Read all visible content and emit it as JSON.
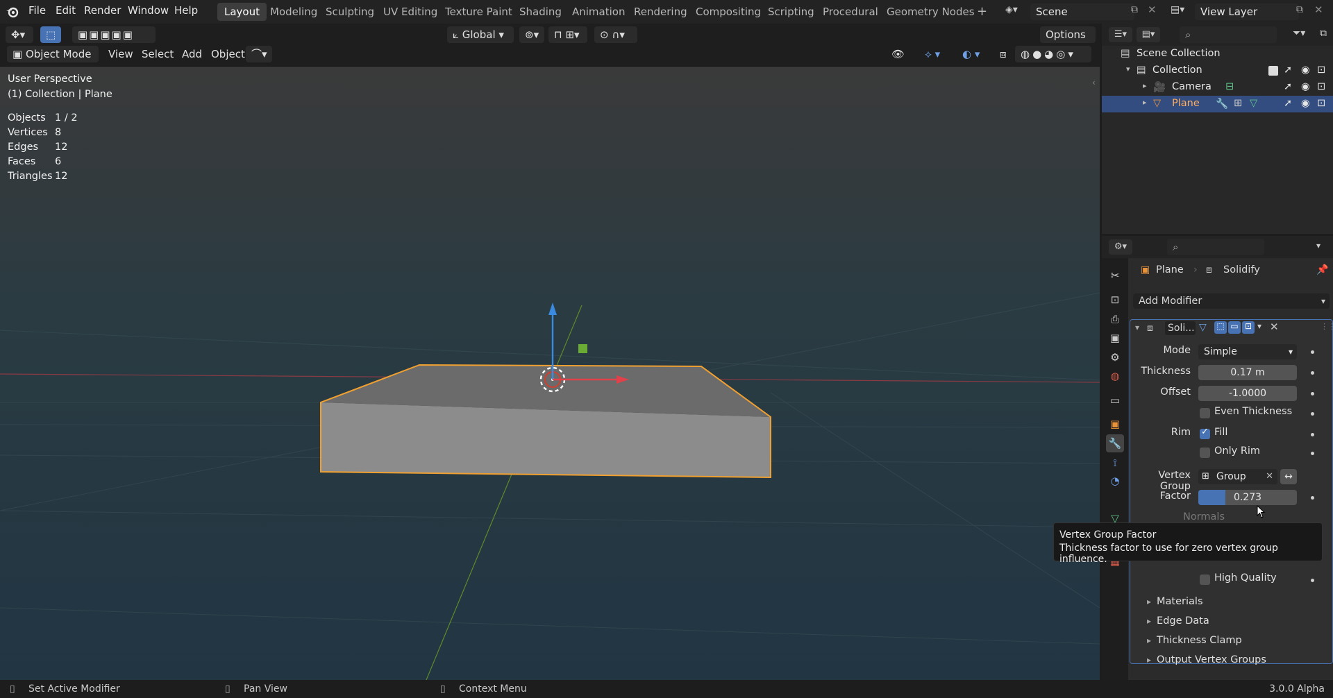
{
  "app": {
    "version": "3.0.0 Alpha"
  },
  "topbar": {
    "menus": [
      "File",
      "Edit",
      "Render",
      "Window",
      "Help"
    ],
    "workspaces": [
      "Layout",
      "Modeling",
      "Sculpting",
      "UV Editing",
      "Texture Paint",
      "Shading",
      "Animation",
      "Rendering",
      "Compositing",
      "Scripting",
      "Procedural",
      "Geometry Nodes"
    ],
    "active_workspace": "Layout",
    "add_tab": "+",
    "scene": "Scene",
    "view_layer": "View Layer"
  },
  "viewport_header": {
    "transform_orientation": "Global",
    "options": "Options",
    "mode": "Object Mode",
    "menus": [
      "View",
      "Select",
      "Add",
      "Object"
    ]
  },
  "viewport": {
    "perspective": "User Perspective",
    "context": "(1) Collection | Plane",
    "stats": [
      {
        "label": "Objects",
        "value": "1 / 2"
      },
      {
        "label": "Vertices",
        "value": "8"
      },
      {
        "label": "Edges",
        "value": "12"
      },
      {
        "label": "Faces",
        "value": "6"
      },
      {
        "label": "Triangles",
        "value": "12"
      }
    ],
    "colors": {
      "selection_outline": "#f0a030",
      "x_axis": "#e0414a",
      "y_axis": "#7fa83a",
      "z_axis": "#3a8ae0"
    }
  },
  "outliner": {
    "root": "Scene Collection",
    "items": [
      {
        "name": "Collection",
        "indent": 1,
        "icon": "collection-icon"
      },
      {
        "name": "Camera",
        "indent": 2,
        "icon": "camera-icon"
      },
      {
        "name": "Plane",
        "indent": 2,
        "icon": "mesh-icon",
        "selected": true
      }
    ]
  },
  "properties": {
    "breadcrumb": {
      "object": "Plane",
      "modifier": "Solidify"
    },
    "add_modifier": "Add Modifier",
    "modifier": {
      "name": "Soli...",
      "mode_label": "Mode",
      "mode_value": "Simple",
      "thickness_label": "Thickness",
      "thickness_value": "0.17 m",
      "offset_label": "Offset",
      "offset_value": "-1.0000",
      "even_thickness": "Even Thickness",
      "rim_label": "Rim",
      "fill": "Fill",
      "only_rim": "Only Rim",
      "vertex_group_label": "Vertex Group",
      "vertex_group_value": "Group",
      "factor_label": "Factor",
      "factor_value": "0.273",
      "factor_fraction": 0.273,
      "normals": "Normals",
      "high_quality": "High Quality",
      "subpanels": [
        "Materials",
        "Edge Data",
        "Thickness Clamp",
        "Output Vertex Groups"
      ]
    }
  },
  "tooltip": {
    "title": "Vertex Group Factor",
    "body": "Thickness factor to use for zero vertex group influence."
  },
  "status_bar": {
    "items": [
      "Set Active Modifier",
      "Pan View",
      "Context Menu"
    ]
  }
}
